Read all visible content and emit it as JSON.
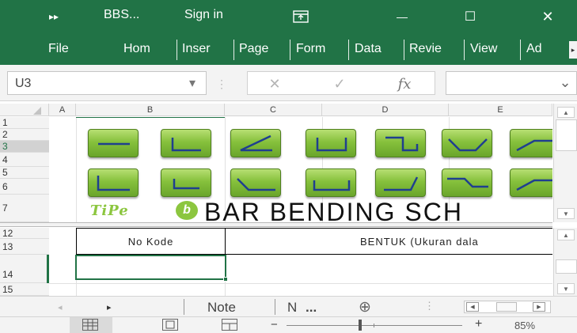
{
  "titlebar": {
    "qat_icon": "more-icon",
    "qat_glyph": "▸▸",
    "filename": "BBS...",
    "signin": "Sign in",
    "ribbon_display_icon": "ribbon-display-icon",
    "minimize_glyph": "—",
    "maximize_glyph": "☐",
    "close_glyph": "✕"
  },
  "ribbon": {
    "tabs": [
      "File",
      "Hom",
      "Inser",
      "Page",
      "Form",
      "Data",
      "Revie",
      "View",
      "Ad"
    ],
    "more_glyph": "▸"
  },
  "formulabar": {
    "namebox_value": "U3",
    "dropdown_glyph": "▾",
    "grip_glyph": "⋮",
    "cancel_glyph": "✕",
    "enter_glyph": "✓",
    "fx_label": "fx",
    "expand_glyph": "⌄"
  },
  "grid": {
    "columns": [
      "A",
      "B",
      "C",
      "D",
      "E"
    ],
    "rows_top": [
      "1",
      "2",
      "3",
      "4",
      "5",
      "6",
      "7"
    ],
    "rows_bottom": [
      "12",
      "13",
      "14",
      "15"
    ],
    "selected_row": "3",
    "active_row": "14",
    "logo_text": "TiPe",
    "logo_mark": "b",
    "title": "BAR BENDING SCH",
    "header_cell_no_kode": "No Kode",
    "header_cell_bentuk": "BENTUK (Ukuran dala"
  },
  "shapes": {
    "row1": [
      "straight",
      "l-hook",
      "angle",
      "u-shape",
      "step",
      "v-shape",
      "partial"
    ],
    "row2": [
      "l-left",
      "l-short",
      "crank",
      "u-wide",
      "j-shape",
      "z-bend",
      "partial"
    ]
  },
  "sheettabs": {
    "prev_glyph": "◂",
    "next_glyph": "▸",
    "tab_note": "Note",
    "tab_other": "N",
    "ellipsis": "...",
    "add_glyph": "⊕",
    "options_glyph": "⋮"
  },
  "statusbar": {
    "normal_view_icon": "grid-icon",
    "page_layout_icon": "page-layout-icon",
    "page_break_icon": "page-break-icon",
    "zoom_out": "−",
    "zoom_in": "+",
    "zoom_level": "85%",
    "zoom_value": 85
  },
  "colors": {
    "accent": "#217346",
    "shape_green": "#86c13c",
    "logo_green": "#8cc63f"
  }
}
